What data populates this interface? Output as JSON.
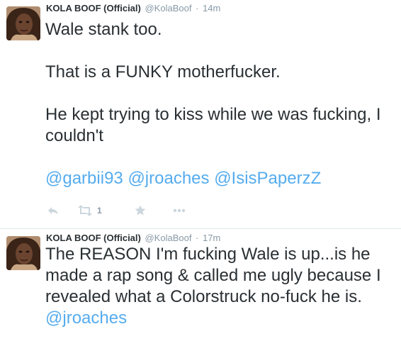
{
  "tweets": [
    {
      "fullname": "KOLA BOOF (Official)",
      "username": "@KolaBoof",
      "separator": "·",
      "time": "14m",
      "paragraphs": [
        "Wale stank too.",
        "That is a FUNKY motherfucker.",
        "He kept trying to kiss while we was fucking, I couldn't"
      ],
      "mentions": [
        "@garbii93",
        "@jroaches",
        "@IsisPaperzZ"
      ],
      "actions": {
        "reply_icon": "reply-icon",
        "retweet_icon": "retweet-icon",
        "retweet_count": "1",
        "favorite_icon": "star-icon",
        "more_icon": "more-dots-icon"
      }
    },
    {
      "fullname": "KOLA BOOF (Official)",
      "username": "@KolaBoof",
      "separator": "·",
      "time": "17m",
      "text": "The REASON I'm fucking Wale is up...is he made a rap song & called me ugly because I revealed what a Colorstruck no-fuck he is.",
      "mention": "@jroaches"
    }
  ],
  "colors": {
    "link": "#55acee",
    "text": "#292f33",
    "meta": "#8899a6",
    "icon": "#ccd6dd",
    "divider": "#e1e8ed"
  }
}
